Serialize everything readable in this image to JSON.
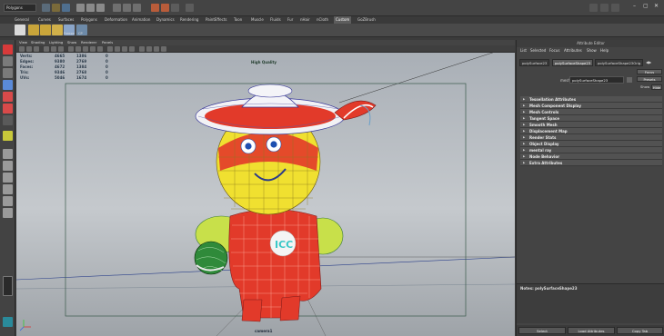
{
  "status_line": {
    "mode": "Polygons",
    "window_controls": [
      "minimize",
      "restore",
      "close"
    ]
  },
  "shelf": {
    "tabs": [
      "General",
      "Curves",
      "Surfaces",
      "Polygons",
      "Deformation",
      "Animation",
      "Dynamics",
      "Rendering",
      "PaintEffects",
      "Toon",
      "Muscle",
      "Fluids",
      "Fur",
      "nHair",
      "nCloth",
      "Custom",
      "GoZBrush"
    ],
    "active_tab": "Custom",
    "buttons": [
      {
        "label": "Nailed",
        "icon": "nailed-icon"
      },
      {
        "label": "",
        "icon": "tool-icon-1"
      },
      {
        "label": "",
        "icon": "tool-icon-2"
      },
      {
        "label": "",
        "icon": "tool-icon-3"
      },
      {
        "label": "Freeze",
        "icon": "freeze-icon"
      },
      {
        "label": "CP",
        "icon": "center-pivot-icon"
      }
    ]
  },
  "toolbox": {
    "tools": [
      "select-tool",
      "lasso-tool",
      "paint-select-tool",
      "move-tool",
      "rotate-tool",
      "scale-tool",
      "last-tool",
      "soft-mod-tool",
      "layout-single",
      "layout-four",
      "layout-side",
      "layout-outliner",
      "layout-graph",
      "layout-hypershade",
      "layout-uv"
    ]
  },
  "viewport": {
    "menus": [
      "View",
      "Shading",
      "Lighting",
      "Show",
      "Renderer",
      "Panels"
    ],
    "hud": {
      "rows": [
        {
          "label": "Verts:",
          "v1": "4665",
          "v2": "1386",
          "v3": "0"
        },
        {
          "label": "Edges:",
          "v1": "9380",
          "v2": "2769",
          "v3": "0"
        },
        {
          "label": "Faces:",
          "v1": "4672",
          "v2": "1384",
          "v3": "0"
        },
        {
          "label": "Tris:",
          "v1": "9346",
          "v2": "2768",
          "v3": "0"
        },
        {
          "label": "UVs:",
          "v1": "5046",
          "v2": "1674",
          "v3": "0"
        }
      ],
      "quality": "High Quality",
      "camera": "camera1"
    },
    "model_letters": "ICC"
  },
  "attribute_editor": {
    "title": "Attribute Editor",
    "menus": [
      "List",
      "Selected",
      "Focus",
      "Attributes",
      "Show",
      "Help"
    ],
    "tabs": [
      "polySurface23",
      "polySurfaceShape23",
      "polySurfaceShape23Orig"
    ],
    "active_tab": "polySurfaceShape23",
    "mesh_label": "mesh:",
    "mesh_value": "polySurfaceShape23",
    "focus_button": "Focus",
    "presets_button": "Presets",
    "show_label": "Show",
    "hide_label": "Hide",
    "sections": [
      "Tessellation Attributes",
      "Mesh Component Display",
      "Mesh Controls",
      "Tangent Space",
      "Smooth Mesh",
      "Displacement Map",
      "Render Stats",
      "Object Display",
      "mental ray",
      "Node Behavior",
      "Extra Attributes"
    ],
    "notes_label": "Notes: polySurfaceShape23",
    "bottom_buttons": [
      "Select",
      "Load Attributes",
      "Copy Tab"
    ]
  }
}
